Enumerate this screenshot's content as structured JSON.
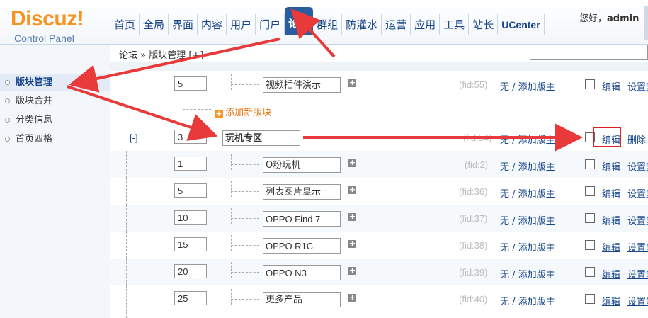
{
  "logo": {
    "main": "Discuz!",
    "sub": "Control Panel"
  },
  "nav": [
    "首页",
    "全局",
    "界面",
    "内容",
    "用户",
    "门户",
    "论坛",
    "群组",
    "防灌水",
    "运营",
    "应用",
    "工具",
    "站长",
    "UCenter"
  ],
  "nav_active": "论坛",
  "greeting": {
    "prefix": "您好，",
    "user": "admin"
  },
  "sidebar": [
    "版块管理",
    "版块合并",
    "分类信息",
    "首页四格"
  ],
  "breadcrumb": "论坛 » 版块管理 [+]",
  "collapse_label": "[-]",
  "add_new_label": "添加新版块",
  "moderator_label": "无 / 添加版主",
  "edit_label": "编辑",
  "delete_label": "删除",
  "settings_label": "设置复",
  "rows": [
    {
      "order": "5",
      "name": "视频插件演示",
      "fid": "(fid:55)"
    },
    {
      "order": "3",
      "name": "玩机专区",
      "fid": "(fid:54)"
    },
    {
      "order": "1",
      "name": "O粉玩机",
      "fid": "(fid:2)"
    },
    {
      "order": "5",
      "name": "列表图片显示",
      "fid": "(fid:36)"
    },
    {
      "order": "10",
      "name": "OPPO Find 7",
      "fid": "(fid:37)"
    },
    {
      "order": "15",
      "name": "OPPO R1C",
      "fid": "(fid:38)"
    },
    {
      "order": "20",
      "name": "OPPO N3",
      "fid": "(fid:39)"
    },
    {
      "order": "25",
      "name": "更多产品",
      "fid": "(fid:40)"
    }
  ],
  "colors": {
    "accent": "#2a5d9e",
    "brand": "#f7931e",
    "arrow": "#e83a3a",
    "link": "#16458a"
  }
}
